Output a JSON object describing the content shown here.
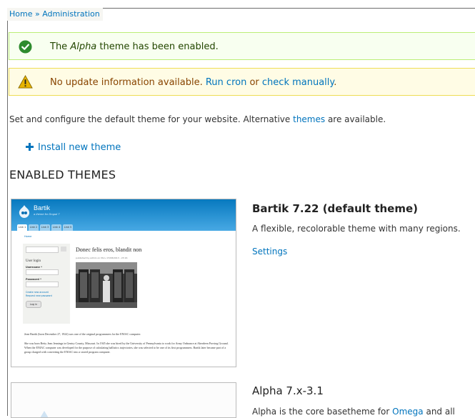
{
  "breadcrumb": {
    "home": "Home",
    "separator": " » ",
    "current": "Administration"
  },
  "status_message": {
    "icon": "check-circle-icon",
    "prefix": "The ",
    "theme_em": "Alpha",
    "suffix": " theme has been enabled."
  },
  "warning_message": {
    "icon": "warning-triangle-icon",
    "prefix": "No update information available. ",
    "run_cron": "Run cron",
    "middle": " or ",
    "check_manually": "check manually",
    "suffix": "."
  },
  "intro": {
    "prefix": "Set and configure the default theme for your website. Alternative ",
    "link": "themes",
    "suffix": " are available."
  },
  "install_link": "Install new theme",
  "section_title": "ENABLED THEMES",
  "themes": [
    {
      "name": "Bartik 7.22 (default theme)",
      "description": "A flexible, recolorable theme with many regions.",
      "settings_link": "Settings",
      "screenshot": {
        "site_name": "Bartik",
        "slogan": "a theme for Drupal 7",
        "tabs": [
          "Link 1",
          "Link 2",
          "Link 3",
          "Link 4",
          "Link 5"
        ],
        "home_crumb": "Home",
        "search_label": "Search",
        "login_title": "User login",
        "username_label": "Username *",
        "password_label": "Password *",
        "create_account": "Create new account",
        "request_password": "Request new password",
        "login_button": "Log in",
        "article_title": "Donec felis eros, blandit non",
        "article_meta": "published by admin on Mon, 07/08/2013 - 23:16",
        "para1": "Jean Bartik (born December 27, 1924) was one of the original programmers for the ENIAC computer.",
        "para2": "She was born Betty Jean Jennings in Gentry County, Missouri. In 1945 she was hired by the University of Pennsylvania to work for Army Ordnance at Aberdeen Proving Ground. When the ENIAC computer was developed for the purpose of calculating ballistics trajectories, she was selected to be one of its first programmers. Bartik later became part of a group charged with converting the ENIAC into a stored program computer."
      }
    },
    {
      "name": "Alpha 7.x-3.1",
      "description_prefix": "Alpha is the core basetheme for ",
      "description_link": "Omega",
      "description_suffix": " and all"
    }
  ],
  "colors": {
    "link": "#0074bd",
    "status_bg": "#f8fff0",
    "warning_bg": "#fffce5",
    "bartik_header": "#0779bf"
  }
}
